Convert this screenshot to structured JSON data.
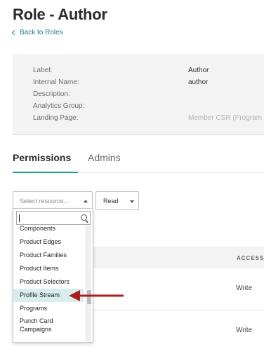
{
  "page": {
    "title": "Role - Author",
    "back_link": "Back to Roles"
  },
  "details": {
    "rows": [
      {
        "label": "Label:",
        "value": "Author"
      },
      {
        "label": "Internal Name:",
        "value": "author"
      },
      {
        "label": "Description:",
        "value": ""
      },
      {
        "label": "Analytics Group:",
        "value": ""
      },
      {
        "label": "Landing Page:",
        "value": "Member CSR (Program"
      }
    ]
  },
  "tabs": [
    {
      "label": "Permissions",
      "active": true
    },
    {
      "label": "Admins",
      "active": false
    }
  ],
  "resource_select": {
    "placeholder": "Select resource...",
    "search_value": "",
    "options": [
      "Components",
      "Product Edges",
      "Product Families",
      "Product Items",
      "Product Selectors",
      "Profile Stream",
      "Programs",
      "Punch Card Campaigns"
    ],
    "highlighted": "Profile Stream"
  },
  "permission_select": {
    "value": "Read"
  },
  "table": {
    "columns": [
      "ACCESS"
    ],
    "rows": [
      {
        "access": "Write"
      },
      {
        "access": "Write"
      }
    ]
  },
  "colors": {
    "accent": "#1f9bae",
    "link": "#1f7a8c",
    "highlight_row": "#d6eeee",
    "annotation_arrow": "#b51a1a"
  },
  "icons": {
    "back": "chevron-left-icon",
    "search": "search-icon",
    "select_open": "caret-up-icon",
    "select_closed": "caret-down-icon"
  }
}
